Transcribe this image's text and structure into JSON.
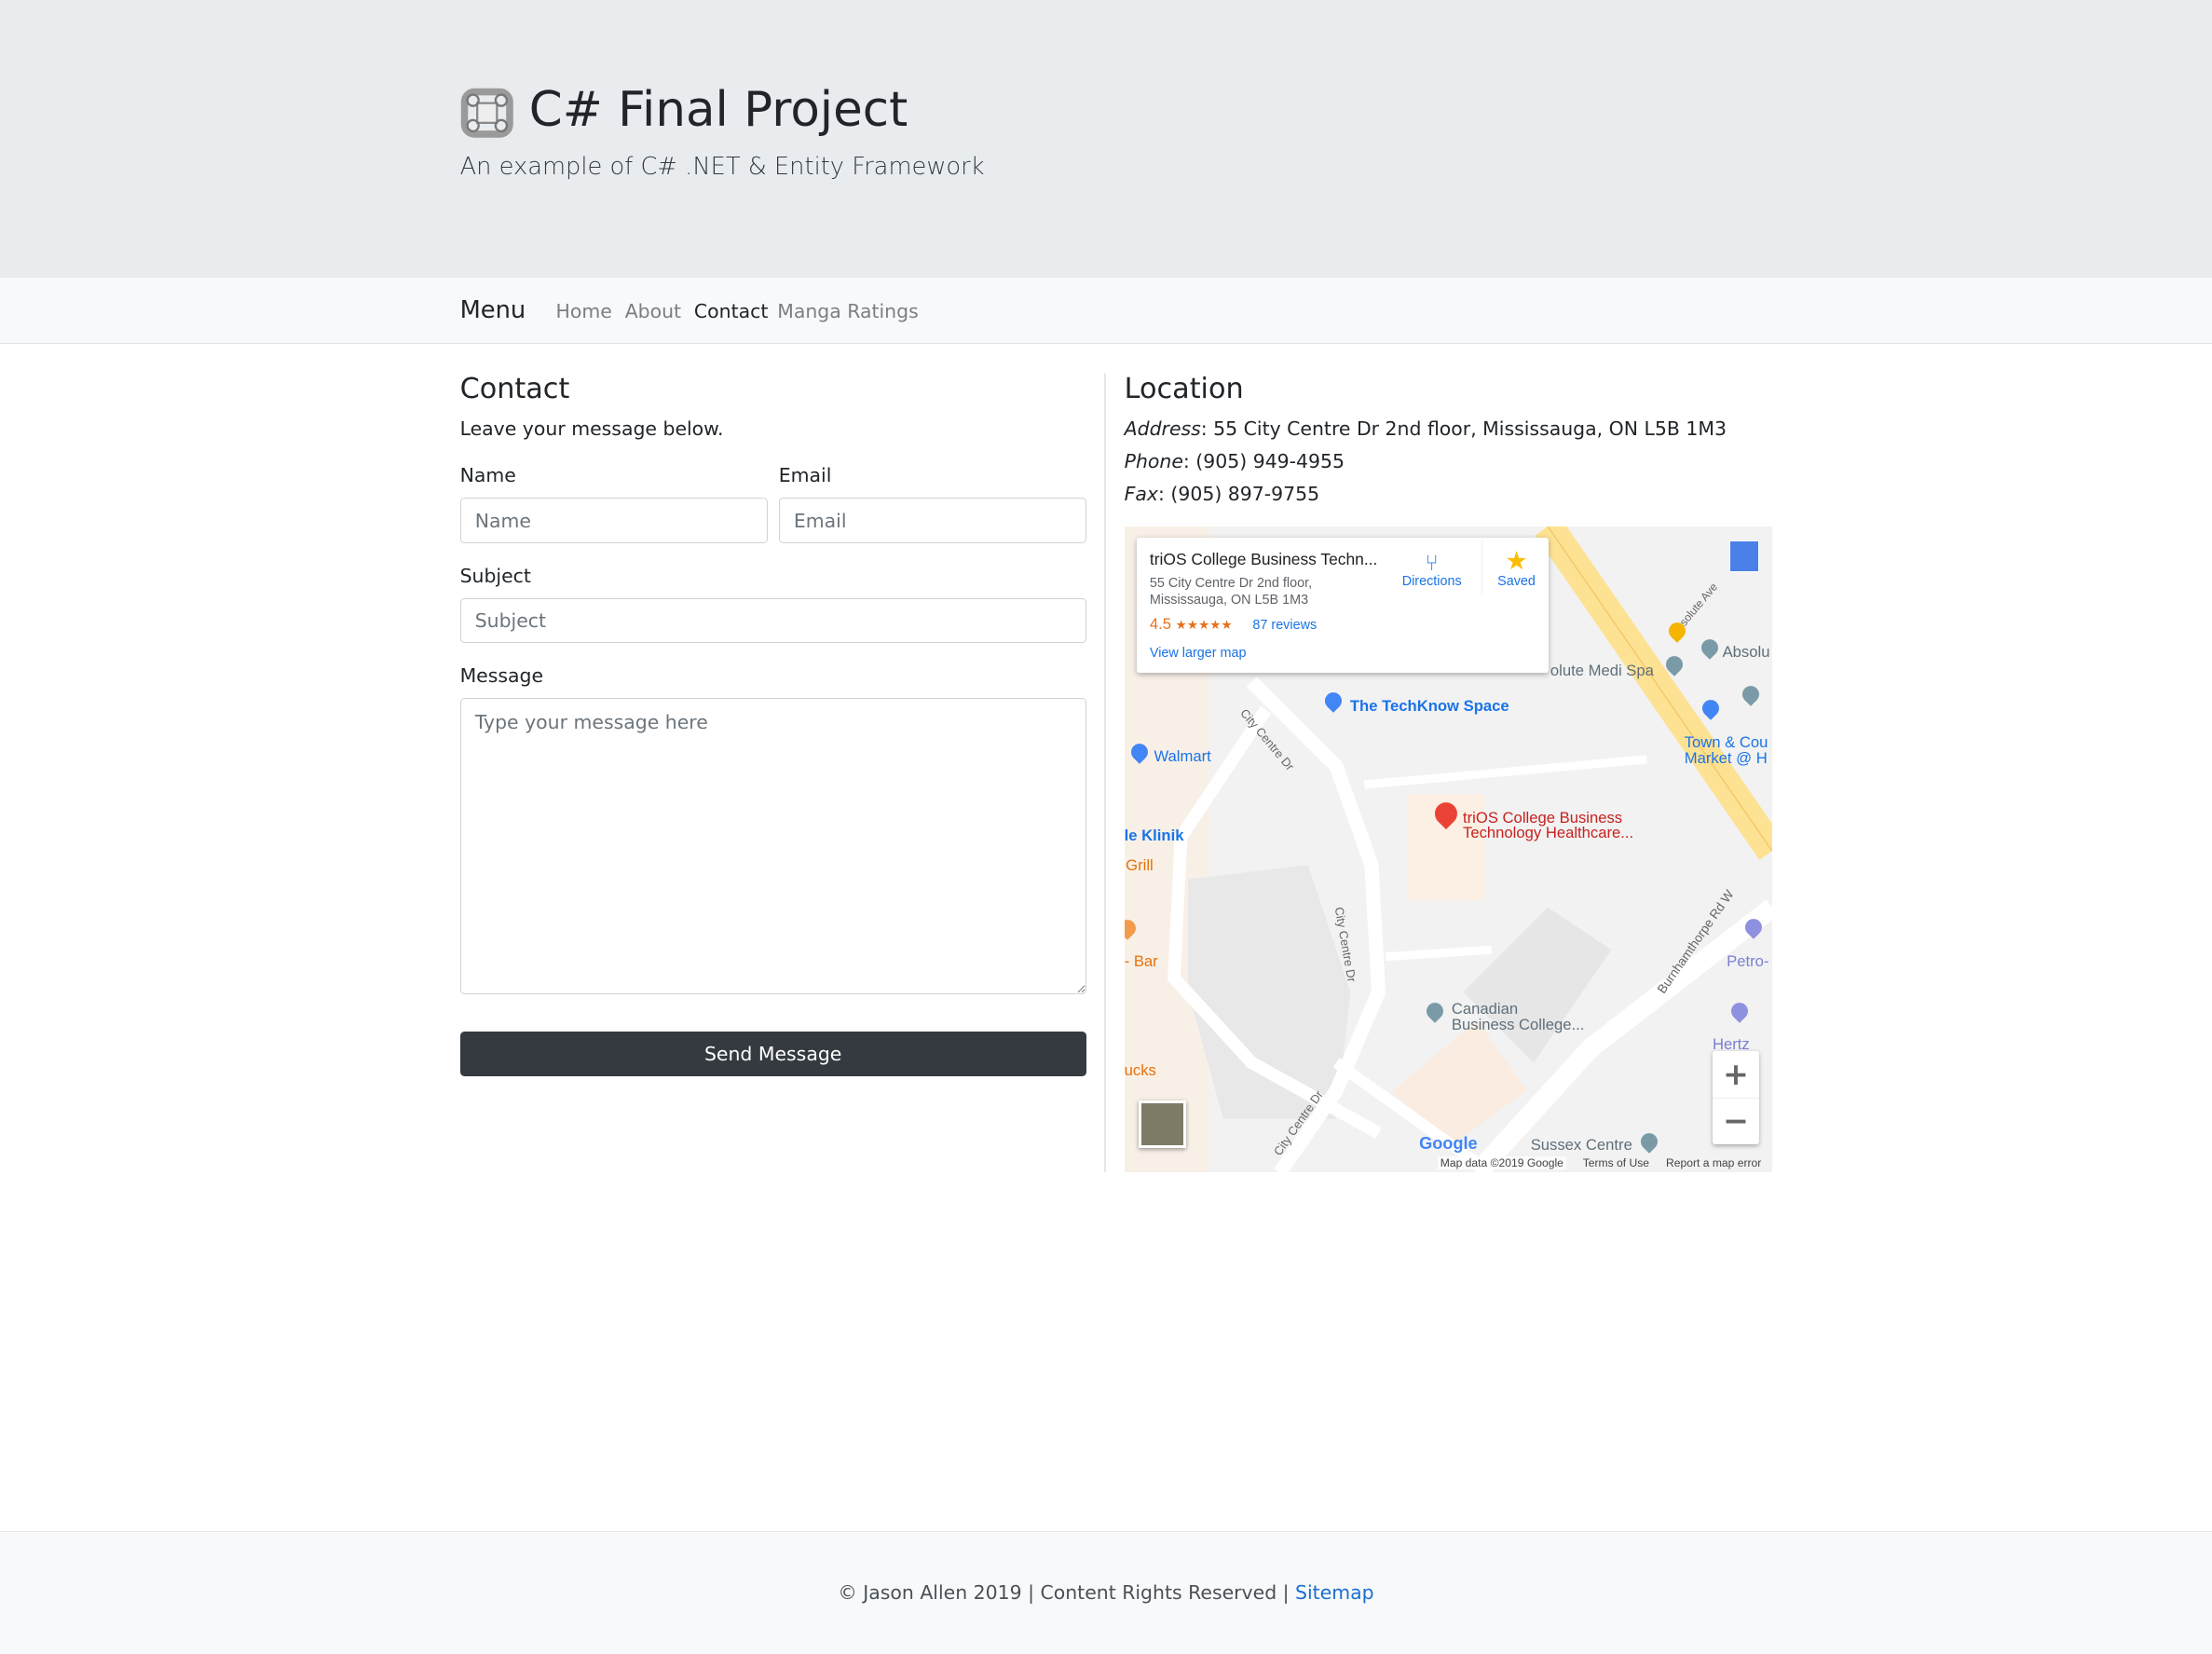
{
  "header": {
    "title": "C# Final Project",
    "subtitle": "An example of C# .NET & Entity Framework",
    "logo_icon": "celtic-knot-logo"
  },
  "nav": {
    "brand": "Menu",
    "items": [
      {
        "label": "Home"
      },
      {
        "label": "About"
      },
      {
        "label": "Contact",
        "active": true
      },
      {
        "label": "Manga Ratings"
      }
    ]
  },
  "contact": {
    "heading": "Contact",
    "intro": "Leave your message below.",
    "name_label": "Name",
    "name_placeholder": "Name",
    "name_value": "",
    "email_label": "Email",
    "email_placeholder": "Email",
    "email_value": "",
    "subject_label": "Subject",
    "subject_placeholder": "Subject",
    "subject_value": "",
    "message_label": "Message",
    "message_placeholder": "Type your message here",
    "message_value": "",
    "send_label": "Send Message",
    "button_color": "#343a40"
  },
  "location": {
    "heading": "Location",
    "address_label": "Address",
    "address": ": 55 City Centre Dr 2nd floor, Mississauga, ON L5B 1M3",
    "phone_label": "Phone",
    "phone": ": (905) 949-4955",
    "fax_label": "Fax",
    "fax": ": (905) 897-9755"
  },
  "map": {
    "card": {
      "title": "triOS College Business Techn...",
      "address_line1": "55 City Centre Dr 2nd floor,",
      "address_line2": "Mississauga, ON L5B 1M3",
      "rating": "4.5",
      "stars": "★★★★★",
      "rating_value": 4.5,
      "reviews": "87 reviews",
      "directions": "Directions",
      "saved": "Saved",
      "larger_map": "View larger map"
    },
    "labels": {
      "techknow": "The TechKnow Space",
      "walmart": "Walmart",
      "klinik": "le Klinik",
      "grill": "Grill",
      "bar": "- Bar",
      "ucks": "ucks",
      "medi_spa": "olute Medi Spa",
      "absolu": "Absolu",
      "town1": "Town & Cou",
      "town2": "Market @ H",
      "petro": "Petro-",
      "hertz": "Hertz",
      "trios1": "triOS College Business",
      "trios2": "Technology Healthcare...",
      "cbc1": "Canadian",
      "cbc2": "Business College...",
      "sussex": "Sussex Centre",
      "street1": "City Centre Dr",
      "street2": "City Centre Dr",
      "street3": "City Centre Dr",
      "street4": "Burnhamthorpe Rd W",
      "street5": "solute Ave",
      "google": "Google",
      "attrib_data": "Map data ©2019 Google",
      "attrib_terms": "Terms of Use",
      "attrib_report": "Report a map error",
      "zoom_in": "+",
      "zoom_out": "−"
    },
    "marker_color": "#ea4335"
  },
  "footer": {
    "text": "© Jason Allen 2019 | Content Rights Reserved | ",
    "link": "Sitemap"
  }
}
